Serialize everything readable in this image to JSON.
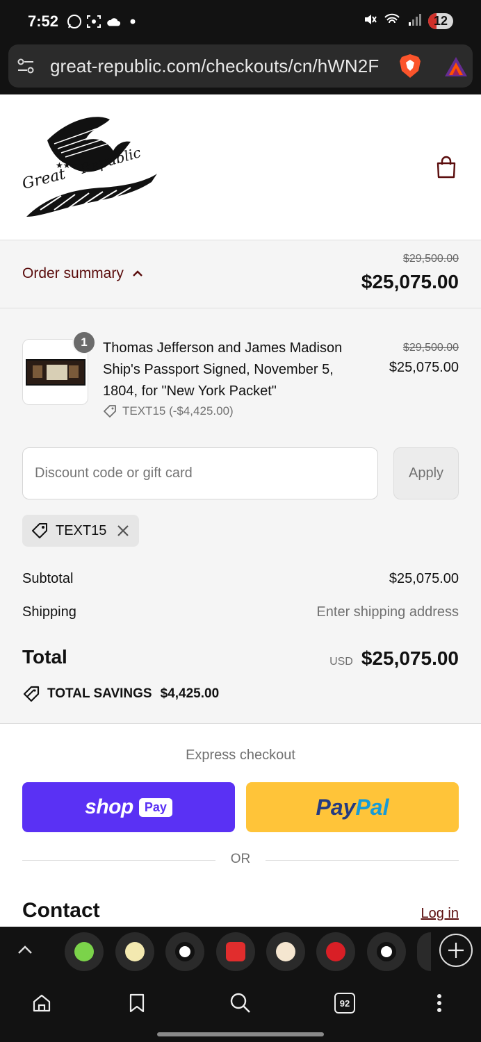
{
  "status_bar": {
    "time": "7:52",
    "battery": "12",
    "icons": [
      "whatsapp-icon",
      "screenshot-icon",
      "cloud-icon",
      "dot-icon",
      "mute-icon",
      "wifi-icon",
      "signal-icon"
    ]
  },
  "browser": {
    "url": "great-republic.com/checkouts/cn/hWN2F",
    "open_tabs_count": "92"
  },
  "header": {
    "logo_alt": "The Great Republic"
  },
  "order_summary": {
    "toggle_label": "Order summary",
    "compare_total": "$29,500.00",
    "total": "$25,075.00"
  },
  "line_item": {
    "quantity": "1",
    "title": "Thomas Jefferson and James Madison Ship's Passport Signed, November 5, 1804, for \"New York Packet\"",
    "discount_code": "TEXT15 (-$4,425.00)",
    "compare_price": "$29,500.00",
    "price": "$25,075.00"
  },
  "discount": {
    "placeholder": "Discount code or gift card",
    "apply_label": "Apply",
    "applied_code": "TEXT15"
  },
  "totals": {
    "subtotal_label": "Subtotal",
    "subtotal_value": "$25,075.00",
    "shipping_label": "Shipping",
    "shipping_value": "Enter shipping address",
    "total_label": "Total",
    "currency": "USD",
    "total_value": "$25,075.00",
    "savings_label": "TOTAL SAVINGS",
    "savings_value": "$4,425.00"
  },
  "express": {
    "label": "Express checkout",
    "shoppay_word": "shop",
    "shoppay_badge": "Pay",
    "paypal_word_1": "Pay",
    "paypal_word_2": "Pal",
    "or_label": "OR"
  },
  "contact": {
    "heading": "Contact",
    "login_label": "Log in"
  },
  "colors": {
    "accent": "#5a0c0c",
    "shoppay": "#5a31f4",
    "paypal": "#ffc439"
  }
}
